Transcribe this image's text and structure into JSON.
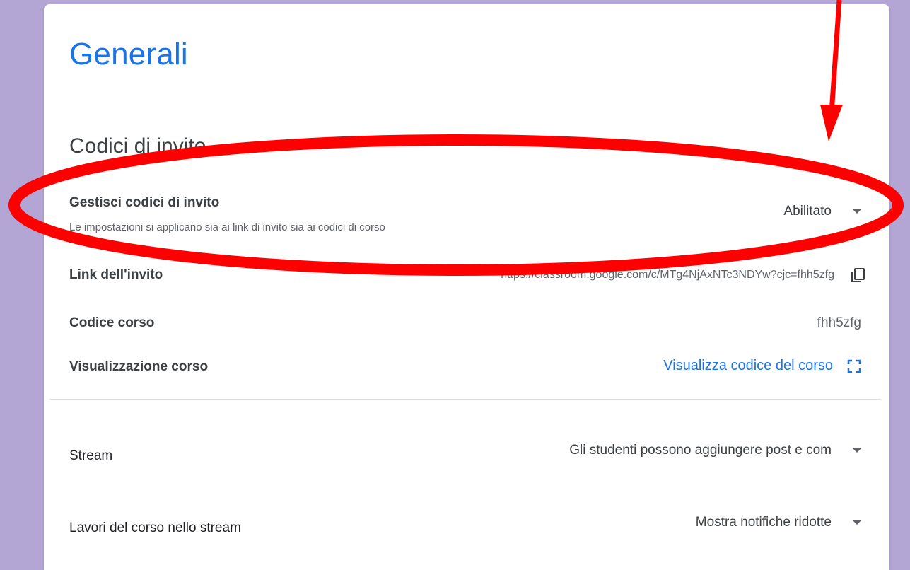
{
  "card": {
    "title": "Generali",
    "section_title": "Codici di invito"
  },
  "invite_codes": {
    "label": "Gestisci codici di invito",
    "sublabel": "Le impostazioni si applicano sia ai link di invito sia ai codici di corso",
    "value": "Abilitato"
  },
  "invite_link": {
    "label": "Link dell'invito",
    "value": "https://classroom.google.com/c/MTg4NjAxNTc3NDYw?cjc=fhh5zfg"
  },
  "course_code": {
    "label": "Codice corso",
    "value": "fhh5zfg"
  },
  "course_view": {
    "label": "Visualizzazione corso",
    "link": "Visualizza codice del corso"
  },
  "stream": {
    "label": "Stream",
    "value": "Gli studenti possono aggiungere post e com"
  },
  "classwork_stream": {
    "label": "Lavori del corso nello stream",
    "value": "Mostra notifiche ridotte"
  },
  "colors": {
    "accent": "#1a73e8",
    "annotation": "#ff0000",
    "background": "#b3a6d5"
  },
  "icons": [
    "copy-icon",
    "fullscreen-icon",
    "dropdown-caret-icon"
  ]
}
